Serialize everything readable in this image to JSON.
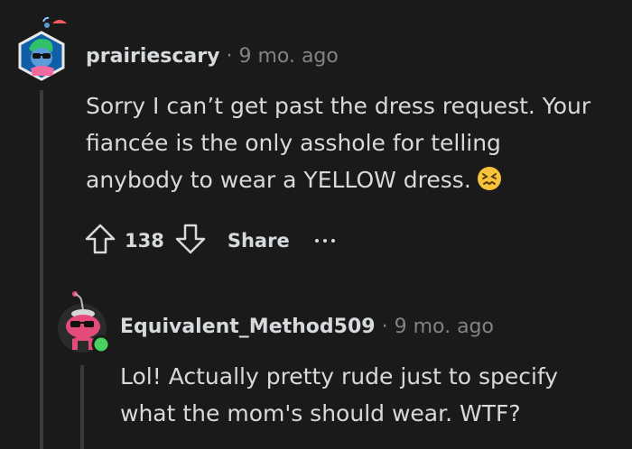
{
  "comment1": {
    "username": "prairiescary",
    "separator": "·",
    "time": "9 mo. ago",
    "body_lines": [
      "Sorry I can’t get past the dress request. Your",
      "fiancée is the only asshole for telling",
      "anybody to wear a YELLOW dress."
    ],
    "emoji": "confounded-face-icon",
    "vote_count": "138",
    "share_label": "Share"
  },
  "comment2": {
    "username": "Equivalent_Method509",
    "separator": "·",
    "time": "9 mo. ago",
    "body_lines": [
      "Lol! Actually pretty rude just to specify",
      "what the mom's should wear. WTF?"
    ]
  },
  "colors": {
    "background": "#1a1a1b",
    "text": "#d7dadc",
    "muted": "#818384",
    "thread_line": "#3a3a3c",
    "online": "#46d160"
  }
}
